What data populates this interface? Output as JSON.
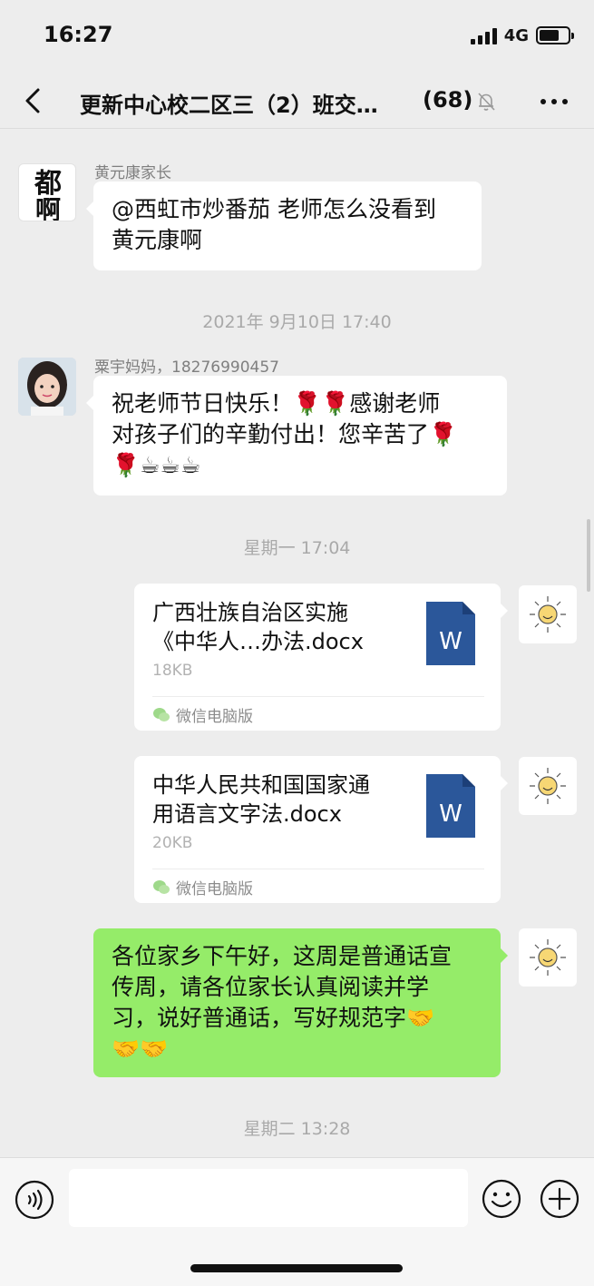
{
  "status_bar": {
    "time": "16:27",
    "network": "4G"
  },
  "nav": {
    "back_icon": "chevron-left-icon",
    "title": "更新中心校二区三（2）班交…",
    "member_count": "(68)",
    "mute_icon": "bell-off-icon",
    "more_icon": "ellipsis-icon"
  },
  "messages": [
    {
      "type": "text-left",
      "sender": "黄元康家长",
      "avatar_glyph": "都啊",
      "text_lines": [
        "@西虹市炒番茄 老师怎么没看到",
        "黄元康啊"
      ]
    },
    {
      "type": "timestamp",
      "text": "2021年 9月10日 17:40"
    },
    {
      "type": "text-left",
      "sender": "粟宇妈妈，18276990457",
      "text_lines": [
        "祝老师节日快乐！🌹🌹感谢老师",
        "对孩子们的辛勤付出！您辛苦了🌹",
        "🌹☕☕☕"
      ]
    },
    {
      "type": "timestamp",
      "text": "星期一 17:04"
    },
    {
      "type": "file-right",
      "file_name_lines": [
        "广西壮族自治区实施",
        "《中华人…办法.docx"
      ],
      "file_size": "18KB",
      "source": "微信电脑版",
      "file_icon_letter": "W"
    },
    {
      "type": "file-right",
      "file_name_lines": [
        "中华人民共和国国家通",
        "用语言文字法.docx"
      ],
      "file_size": "20KB",
      "source": "微信电脑版",
      "file_icon_letter": "W"
    },
    {
      "type": "text-right-green",
      "text_lines": [
        "各位家乡下午好，这周是普通话宣",
        "传周，请各位家长认真阅读并学",
        "习，说好普通话，写好规范字🤝",
        "🤝🤝"
      ]
    },
    {
      "type": "timestamp",
      "text": "星期二 13:28"
    }
  ],
  "input_bar": {
    "voice_icon": "voice-icon",
    "placeholder": "",
    "emoji_icon": "smiley-icon",
    "plus_icon": "plus-icon"
  },
  "colors": {
    "background": "#ededed",
    "green_bubble": "#95ec69",
    "file_icon_blue": "#2b579a"
  }
}
